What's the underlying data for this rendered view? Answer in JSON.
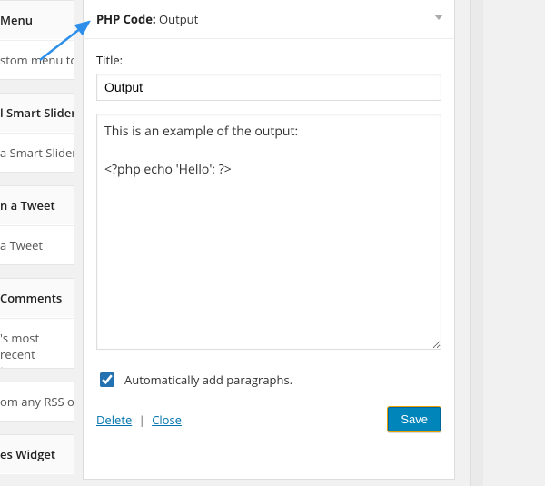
{
  "sidebar": {
    "items": [
      {
        "title": "Menu",
        "desc": "stom menu to j"
      },
      {
        "title": "l Smart Slider",
        "desc": "a Smart Slider"
      },
      {
        "title": "n a Tweet",
        "desc": "a Tweet"
      },
      {
        "title": "Comments",
        "desc": "'s most recent\nts."
      },
      {
        "title": "",
        "desc": "om any RSS or"
      },
      {
        "title": "es Widget",
        "desc": ""
      }
    ]
  },
  "widget": {
    "heading_bold": "PHP Code:",
    "heading_rest": "Output",
    "title_label": "Title:",
    "title_value": "Output",
    "textarea_value": "This is an example of the output:\n\n<?php echo 'Hello'; ?>",
    "checkbox_label": "Automatically add paragraphs.",
    "checkbox_checked": true,
    "delete_label": "Delete",
    "close_label": "Close",
    "save_label": "Save"
  }
}
